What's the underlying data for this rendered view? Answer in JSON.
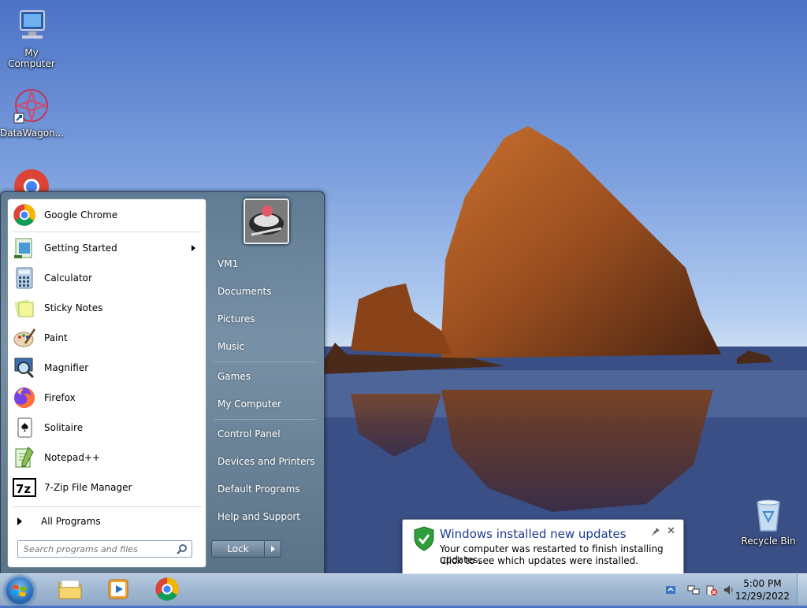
{
  "desktop": {
    "icons": [
      {
        "label": "My Computer"
      },
      {
        "label": "DataWagon..."
      },
      {
        "label": "Recycle Bin"
      }
    ]
  },
  "start_menu": {
    "programs": [
      {
        "label": "Google Chrome",
        "icon": "chrome-icon"
      },
      {
        "label": "Getting Started",
        "icon": "getting-started-icon",
        "has_submenu": true
      },
      {
        "label": "Calculator",
        "icon": "calculator-icon"
      },
      {
        "label": "Sticky Notes",
        "icon": "sticky-notes-icon"
      },
      {
        "label": "Paint",
        "icon": "paint-icon"
      },
      {
        "label": "Magnifier",
        "icon": "magnifier-icon"
      },
      {
        "label": "Firefox",
        "icon": "firefox-icon"
      },
      {
        "label": "Solitaire",
        "icon": "solitaire-icon"
      },
      {
        "label": "Notepad++",
        "icon": "notepadpp-icon"
      },
      {
        "label": "7-Zip File Manager",
        "icon": "7zip-icon"
      }
    ],
    "all_programs": "All Programs",
    "search_placeholder": "Search programs and files",
    "right_links": [
      "VM1",
      "Documents",
      "Pictures",
      "Music",
      "Games",
      "My Computer",
      "Control Panel",
      "Devices and Printers",
      "Default Programs",
      "Help and Support"
    ],
    "lock_label": "Lock"
  },
  "notification": {
    "title": "Windows installed new updates",
    "line1": "Your computer was restarted to finish installing updates.",
    "line2": "Click to see which updates were installed.",
    "close": "✕"
  },
  "taskbar": {
    "time": "5:00 PM",
    "date": "12/29/2022"
  }
}
